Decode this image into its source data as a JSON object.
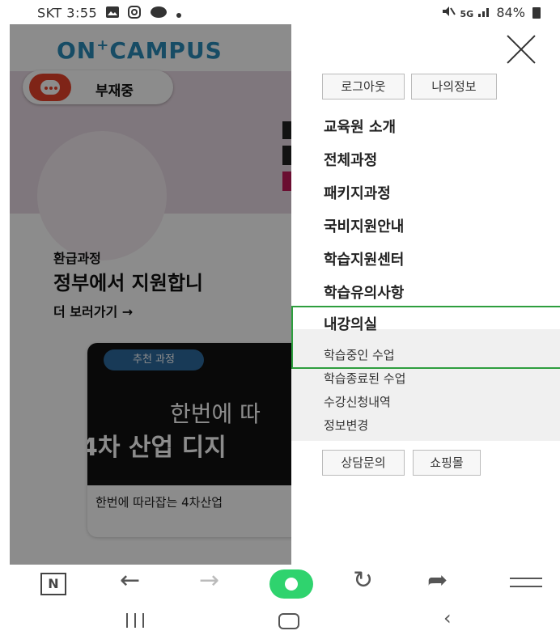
{
  "status_bar": {
    "left_text": "SKT 3:55",
    "icons": [
      "gallery-icon",
      "instagram-icon",
      "talk-icon",
      "dot-icon"
    ],
    "right_text": "84%",
    "right_icons": [
      "mute-icon",
      "5g-icon",
      "signal-icon",
      "battery-icon"
    ],
    "network": "5G"
  },
  "background_page": {
    "logo": "ON CAMPUS",
    "logo_plus": "+",
    "chat_widget_label": "부재중",
    "refund_small": "환급과정",
    "refund_big": "정부에서 지원합니",
    "more_link": "더 보러가기  →",
    "card": {
      "tag": "추천 과정",
      "title_line1": "한번에 따",
      "title_line2": "4차 산업 디지",
      "caption": "한번에 따라잡는 4차산업"
    }
  },
  "drawer": {
    "top_buttons": [
      "로그아웃",
      "나의정보"
    ],
    "menu": [
      "교육원 소개",
      "전체과정",
      "패키지과정",
      "국비지원안내",
      "학습지원센터",
      "학습유의사항",
      "내강의실"
    ],
    "sub_menu": [
      "학습중인 수업",
      "학습종료된 수업",
      "수강신청내역",
      "정보변경"
    ],
    "bottom_buttons": [
      "상담문의",
      "쇼핑몰"
    ],
    "highlight_color": "#2e9e3e"
  },
  "browser_toolbar": {
    "n_label": "N",
    "home_color": "#2fd36e"
  }
}
